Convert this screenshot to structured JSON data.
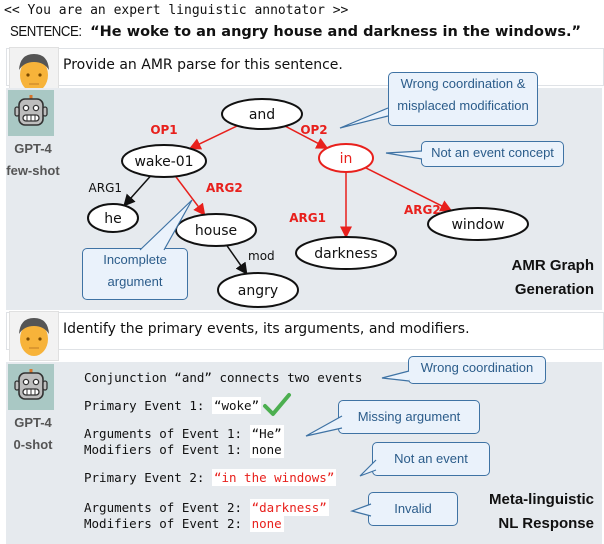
{
  "system_prompt": "<< You are an expert linguistic annotator >>",
  "sentence": {
    "label": "SENTENCE:",
    "text": "“He woke to an angry house and darkness in the windows.”"
  },
  "turn1": {
    "user_prompt": "Provide an AMR parse for this sentence.",
    "model": {
      "name": "GPT-4",
      "setting": "few-shot"
    },
    "panel_title": {
      "line1": "AMR Graph",
      "line2": "Generation"
    },
    "graph": {
      "nodes": [
        {
          "id": "and",
          "label": "and",
          "error": false
        },
        {
          "id": "wake",
          "label": "wake-01",
          "error": false
        },
        {
          "id": "in",
          "label": "in",
          "error": true
        },
        {
          "id": "he",
          "label": "he",
          "error": false
        },
        {
          "id": "house",
          "label": "house",
          "error": false
        },
        {
          "id": "darkness",
          "label": "darkness",
          "error": false
        },
        {
          "id": "window",
          "label": "window",
          "error": false
        },
        {
          "id": "angry",
          "label": "angry",
          "error": false
        }
      ],
      "edges": [
        {
          "from": "and",
          "to": "wake",
          "label": "OP1",
          "error": true
        },
        {
          "from": "and",
          "to": "in",
          "label": "OP2",
          "error": true
        },
        {
          "from": "wake",
          "to": "he",
          "label": "ARG1",
          "error": false
        },
        {
          "from": "wake",
          "to": "house",
          "label": "ARG2",
          "error": true
        },
        {
          "from": "in",
          "to": "darkness",
          "label": "ARG1",
          "error": true
        },
        {
          "from": "in",
          "to": "window",
          "label": "ARG2",
          "error": true
        },
        {
          "from": "house",
          "to": "angry",
          "label": "mod",
          "error": false
        }
      ]
    },
    "callouts": [
      {
        "line1": "Wrong coordination &",
        "line2": "misplaced modification"
      },
      {
        "line1": "Not an event concept"
      },
      {
        "line1": "Incomplete",
        "line2": "argument"
      }
    ]
  },
  "turn2": {
    "user_prompt": "Identify the primary events, its arguments, and modifiers.",
    "model": {
      "name": "GPT-4",
      "setting": "0-shot"
    },
    "panel_title": {
      "line1": "Meta-linguistic",
      "line2": "NL Response"
    },
    "lines": [
      {
        "key": "Conjunction “and” connects two events",
        "value": ""
      },
      {
        "key": "Primary Event 1: ",
        "value": "“woke”"
      },
      {
        "key": "Arguments of Event 1: ",
        "value": "“He”"
      },
      {
        "key": "Modifiers of Event 1: ",
        "value": "none"
      },
      {
        "key": "Primary Event 2: ",
        "value": "“in the windows”"
      },
      {
        "key": "Arguments of Event 2: ",
        "value": "“darkness”"
      },
      {
        "key": "Modifiers of Event 2: ",
        "value": "none"
      }
    ],
    "callouts": [
      {
        "line1": "Wrong coordination"
      },
      {
        "line1": "Missing argument"
      },
      {
        "line1": "Not an event"
      },
      {
        "line1": "Invalid"
      }
    ]
  },
  "colors": {
    "error": "#e8201c",
    "callout_border": "#3f73a4",
    "callout_fill": "#eaf2fb",
    "panel_bg": "#e6eaee",
    "check": "#4caf50"
  }
}
